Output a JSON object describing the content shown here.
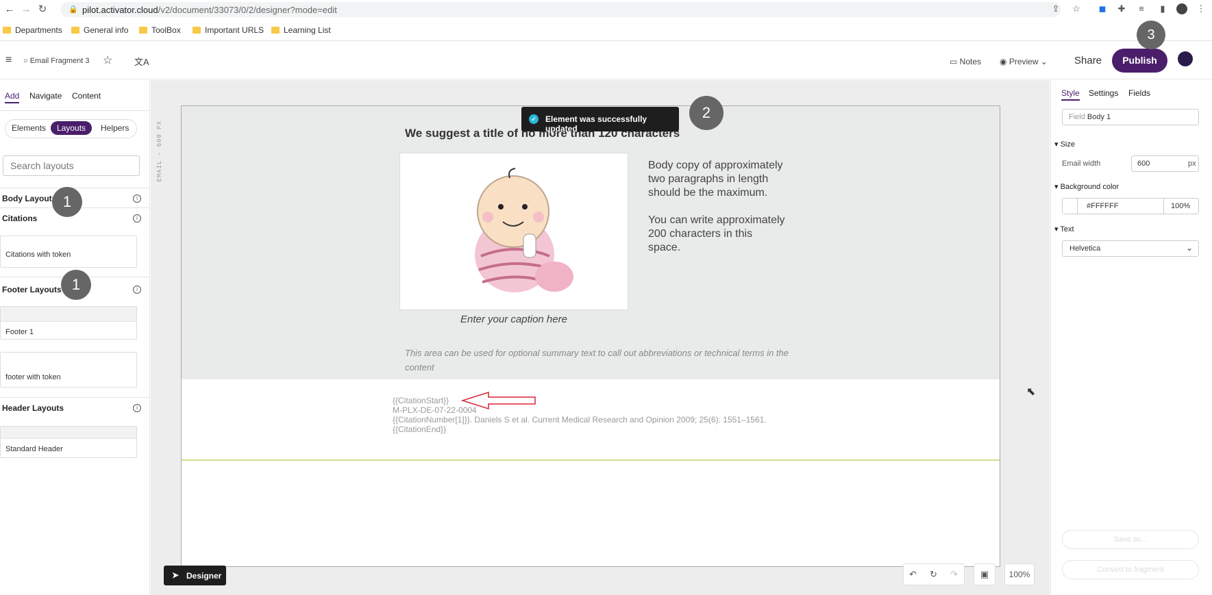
{
  "browser": {
    "url_host": "pilot.activator.cloud",
    "url_path": "/v2/document/33073/0/2/designer?mode=edit",
    "bookmarks": [
      "Departments",
      "General info",
      "ToolBox",
      "Important URLS",
      "Learning List"
    ]
  },
  "header": {
    "doc_name": "Email Fragment 3",
    "notes_label": "Notes",
    "preview_label": "Preview",
    "share_label": "Share",
    "publish_label": "Publish"
  },
  "markers": {
    "m1": "1",
    "m2": "2",
    "m3": "3"
  },
  "left": {
    "tabs": [
      "Add",
      "Navigate",
      "Content"
    ],
    "segments": [
      "Elements",
      "Layouts",
      "Helpers"
    ],
    "search_placeholder": "Search layouts",
    "sections": {
      "body": "Body Layouts",
      "citations": "Citations",
      "footer": "Footer Layouts",
      "header": "Header Layouts"
    },
    "cards": {
      "citations_token": "Citations with token",
      "footer1": "Footer 1",
      "footer_token": "footer with token",
      "standard_header": "Standard Header"
    }
  },
  "email": {
    "ruler": "EMAIL - 600 PX",
    "title": "We suggest a title of no more than 120 characters",
    "body_p1": "Body copy of approximately two paragraphs in length should be the maximum.",
    "body_p2": "You can write approximately 200 characters in this space.",
    "caption": "Enter your caption here",
    "summary": "This area can be used for optional summary text to call out abbreviations or technical terms in the content",
    "citation_lines": [
      "{{CitationStart}}",
      "M-PLX-DE-07-22-0004",
      "{{CitationNumber[1]}}. Daniels S et al. Current Medical Research and Opinion 2009; 25(6): 1551–1561.",
      "{{CitationEnd}}"
    ]
  },
  "toast": {
    "message": "Element was successfully updated"
  },
  "right": {
    "tabs": [
      "Style",
      "Settings",
      "Fields"
    ],
    "field_label": "Field",
    "field_value": "Body 1",
    "size_label": "Size",
    "email_width_label": "Email width",
    "email_width_value": "600",
    "email_width_unit": "px",
    "bg_label": "Background color",
    "bg_hex": "#FFFFFF",
    "bg_opacity": "100%",
    "text_label": "Text",
    "font_value": "Helvetica",
    "save_as": "Save as...",
    "convert": "Convert to fragment"
  },
  "bottom": {
    "designer_label": "Designer",
    "zoom": "100%"
  },
  "colors": {
    "accent": "#4a1e6b",
    "toast_bg": "#1e1e1e"
  }
}
